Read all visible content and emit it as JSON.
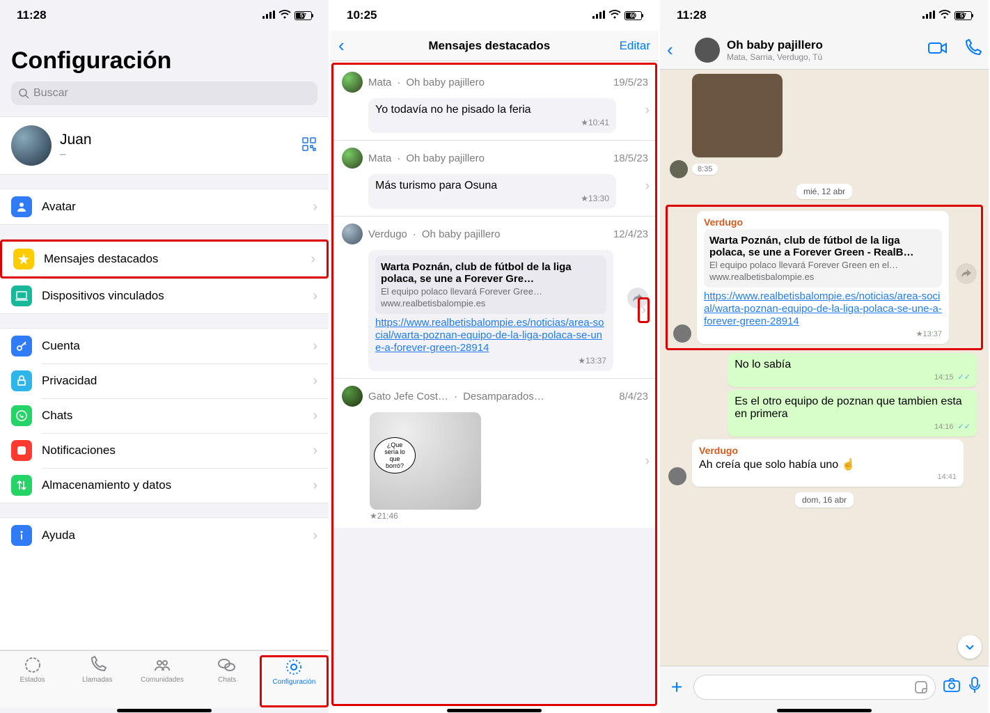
{
  "screen1": {
    "time": "11:28",
    "battery": "57",
    "title": "Configuración",
    "search_placeholder": "Buscar",
    "profile": {
      "name": "Juan",
      "status": "–"
    },
    "rows": {
      "avatar": "Avatar",
      "starred": "Mensajes destacados",
      "linked": "Dispositivos vinculados",
      "account": "Cuenta",
      "privacy": "Privacidad",
      "chats": "Chats",
      "notif": "Notificaciones",
      "storage": "Almacenamiento y datos",
      "help": "Ayuda"
    },
    "tabs": {
      "status": "Estados",
      "calls": "Llamadas",
      "communities": "Comunidades",
      "chats": "Chats",
      "settings": "Configuración"
    }
  },
  "screen2": {
    "time": "10:25",
    "battery": "60",
    "title": "Mensajes destacados",
    "edit": "Editar",
    "msgs": [
      {
        "from": "Mata",
        "group": "Oh baby pajillero",
        "date": "19/5/23",
        "text": "Yo todavía no he pisado la feria",
        "time": "10:41"
      },
      {
        "from": "Mata",
        "group": "Oh baby pajillero",
        "date": "18/5/23",
        "text": "Más turismo para Osuna",
        "time": "13:30"
      },
      {
        "from": "Verdugo",
        "group": "Oh baby pajillero",
        "date": "12/4/23",
        "preview": {
          "title": "Warta Poznán, club de fútbol de la liga polaca, se une a Forever Gre…",
          "sub": "El equipo polaco llevará Forever Gree…",
          "domain": "www.realbetisbalompie.es"
        },
        "link": "https://www.realbetisbalompie.es/noticias/area-social/warta-poznan-equipo-de-la-liga-polaca-se-une-a-forever-green-28914",
        "time": "13:37"
      },
      {
        "from": "Gato Jefe Cost…",
        "group": "Desamparados…",
        "date": "8/4/23",
        "sticker_caption": "¿Que sería lo que borró?",
        "time": "21:46"
      }
    ]
  },
  "screen3": {
    "time": "11:28",
    "battery": "57",
    "chat_name": "Oh baby pajillero",
    "members": "Mata, Sarria, Verdugo, Tú",
    "img_time": "8:35",
    "date1": "mié, 12 abr",
    "verdugo_msg": {
      "sender": "Verdugo",
      "preview_title": "Warta Poznán, club de fútbol de la liga polaca, se une a Forever Green - RealB…",
      "preview_sub": "El equipo polaco llevará Forever Green en el…",
      "preview_domain": "www.realbetisbalompie.es",
      "link": "https://www.realbetisbalompie.es/noticias/area-social/warta-poznan-equipo-de-la-liga-polaca-se-une-a-forever-green-28914",
      "time": "13:37"
    },
    "out1": {
      "text": "No lo sabía",
      "time": "14:15"
    },
    "out2": {
      "text": "Es el otro equipo de poznan que tambien esta en primera",
      "time": "14:16"
    },
    "in2": {
      "sender": "Verdugo",
      "text": "Ah creía que solo había uno ☝️",
      "time": "14:41"
    },
    "date2": "dom, 16 abr"
  }
}
